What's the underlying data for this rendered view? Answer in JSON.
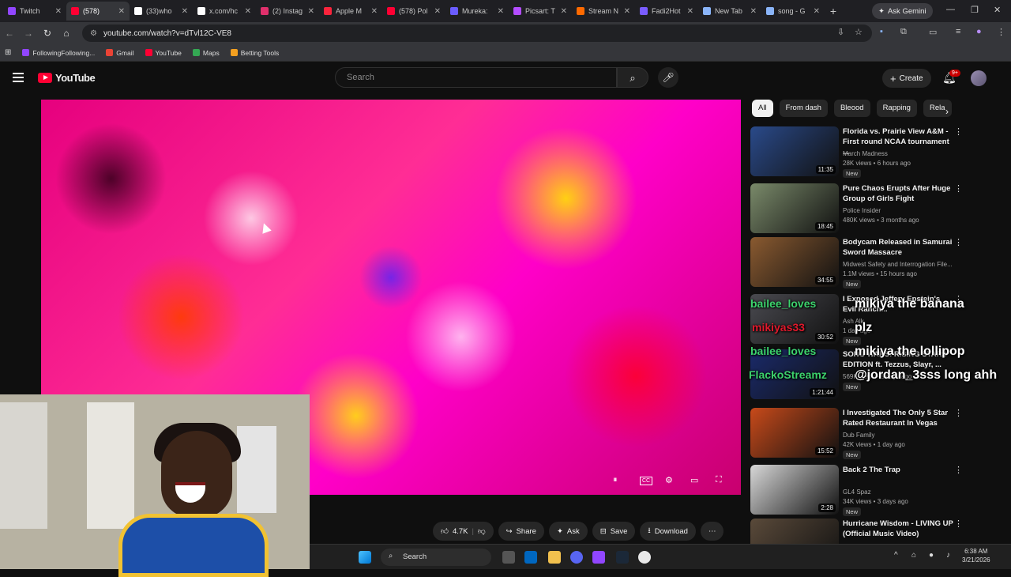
{
  "browser": {
    "tabs": [
      {
        "label": "Twitch",
        "color": "#9146ff"
      },
      {
        "label": "(578)",
        "color": "#ff0033",
        "active": true
      },
      {
        "label": "(33)who",
        "color": "#ffffff"
      },
      {
        "label": "x.com/hc",
        "color": "#ffffff"
      },
      {
        "label": "(2) Instag",
        "color": "#e1306c"
      },
      {
        "label": "Apple M",
        "color": "#fa243c"
      },
      {
        "label": "(578) Pol",
        "color": "#ff0033"
      },
      {
        "label": "Mureka:",
        "color": "#6a5cff"
      },
      {
        "label": "Picsart: T",
        "color": "#b44dff"
      },
      {
        "label": "Stream N",
        "color": "#ff6a00"
      },
      {
        "label": "Fadi2Hot",
        "color": "#7a5cff"
      },
      {
        "label": "New Tab",
        "color": "#8ab4f8"
      },
      {
        "label": "song - G",
        "color": "#8ab4f8"
      }
    ],
    "ask_gemini": "Ask Gemini",
    "url": "youtube.com/watch?v=dTvl12C-VE8",
    "bookmarks": [
      {
        "label": "FollowingFollowing...",
        "color": "#9146ff"
      },
      {
        "label": "Gmail",
        "color": "#ea4335"
      },
      {
        "label": "YouTube",
        "color": "#ff0033"
      },
      {
        "label": "Maps",
        "color": "#34a853"
      },
      {
        "label": "Betting Tools",
        "color": "#f4a020"
      }
    ]
  },
  "youtube": {
    "logo": "YouTube",
    "search_placeholder": "Search",
    "create_label": "Create",
    "notif_badge": "9+",
    "chips": [
      "All",
      "From dash",
      "Bleood",
      "Rapping",
      "Rela"
    ],
    "actions": {
      "likes": "4.7K",
      "share": "Share",
      "ask": "Ask",
      "save": "Save",
      "download": "Download"
    },
    "recommendations": [
      {
        "title": "Florida vs. Prairie View A&M - First round NCAA tournament ...",
        "channel": "March Madness",
        "meta": "28K views • 6 hours ago",
        "badge": "New",
        "duration": "11:35",
        "thumb": "#2a4a8a"
      },
      {
        "title": "Pure Chaos Erupts After Huge Group of Girls Fight",
        "channel": "Police Insider",
        "meta": "480K views • 3 months ago",
        "badge": "",
        "duration": "18:45",
        "thumb": "#7a8a6a"
      },
      {
        "title": "Bodycam Released in Samurai Sword Massacre",
        "channel": "Midwest Safety",
        "meta": "1.1M views • 15 hours ago",
        "badge": "New",
        "duration": "34:55",
        "thumb": "#8a5a30",
        "channel_extra": "and Interrogation File..."
      },
      {
        "title": "I Exposed Jeffery Epstein's Evil Ranch...",
        "channel": "Ash Alk",
        "meta": "1 day ago",
        "badge": "New",
        "duration": "30:52",
        "thumb": "#4a4a50"
      },
      {
        "title": "SONG WARS: RISING STARS EDITION ft. Tezzus, Slayr, ...",
        "channel": "",
        "meta": "569K views • 5 days ago",
        "badge": "New",
        "duration": "1:21:44",
        "thumb": "#1a2a6a"
      },
      {
        "title": "I Investigated The Only 5 Star Rated Restaurant In Vegas",
        "channel": "Dub Family",
        "meta": "42K views • 1 day ago",
        "badge": "New",
        "duration": "15:52",
        "thumb": "#c84a1a"
      },
      {
        "title": "Back 2 The Trap",
        "channel": "GL4 Spaz",
        "meta": "34K views • 3 days ago",
        "badge": "New",
        "duration": "2:28",
        "thumb": "#d8d8d8"
      },
      {
        "title": "Hurricane Wisdom - LIVING UP (Official Music Video)",
        "channel": "",
        "meta": "",
        "badge": "",
        "duration": "",
        "thumb": "#5a4a3a"
      }
    ]
  },
  "stream_overlay": [
    {
      "text": "bailee_loves",
      "kind": "name"
    },
    {
      "text": "mikiya the banana",
      "kind": "msg"
    },
    {
      "text": "mikiyas33",
      "kind": "red"
    },
    {
      "text": "plz",
      "kind": "msg"
    },
    {
      "text": "bailee_loves",
      "kind": "name"
    },
    {
      "text": "mikiya the lollipop",
      "kind": "msg"
    },
    {
      "text": "FlackoStreamz",
      "kind": "name"
    },
    {
      "text": "@jordan_3sss long ahh",
      "kind": "msg"
    }
  ],
  "taskbar": {
    "search": "Search",
    "time": "6:38 AM",
    "date": "3/21/2026"
  }
}
